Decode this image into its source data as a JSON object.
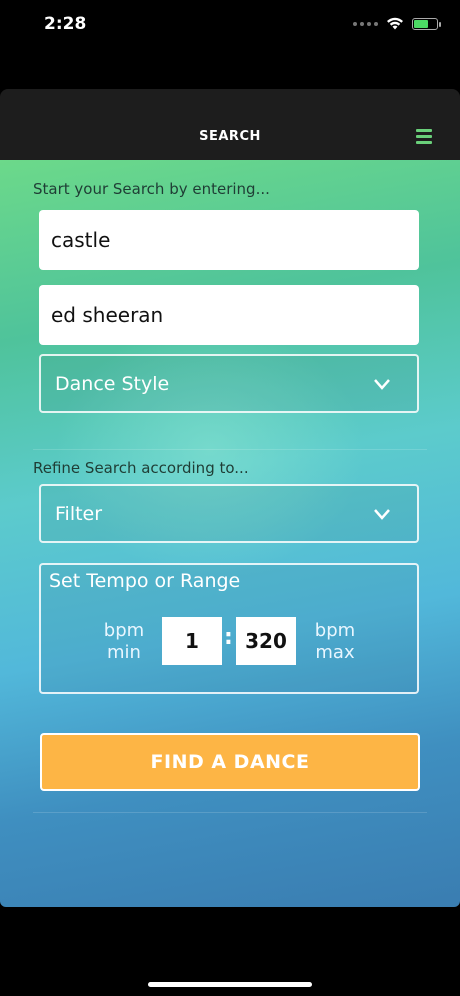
{
  "status_bar": {
    "time": "2:28"
  },
  "header": {
    "title": "SEARCH",
    "menu_icon": "hamburger-menu-icon"
  },
  "search": {
    "label": "Start your Search by entering...",
    "song_value": "castle",
    "artist_value": "ed sheeran",
    "dance_style_label": "Dance Style"
  },
  "refine": {
    "label": "Refine Search according to...",
    "filter_label": "Filter"
  },
  "tempo": {
    "title": "Set Tempo or Range",
    "min_label_1": "bpm",
    "min_label_2": "min",
    "max_label_1": "bpm",
    "max_label_2": "max",
    "min_value": "1",
    "max_value": "320",
    "separator": ":"
  },
  "action": {
    "find_label": "FIND A DANCE"
  },
  "colors": {
    "accent_green": "#6ad07a",
    "button_orange": "#fdb545",
    "header_bg": "#1d1d1d"
  }
}
